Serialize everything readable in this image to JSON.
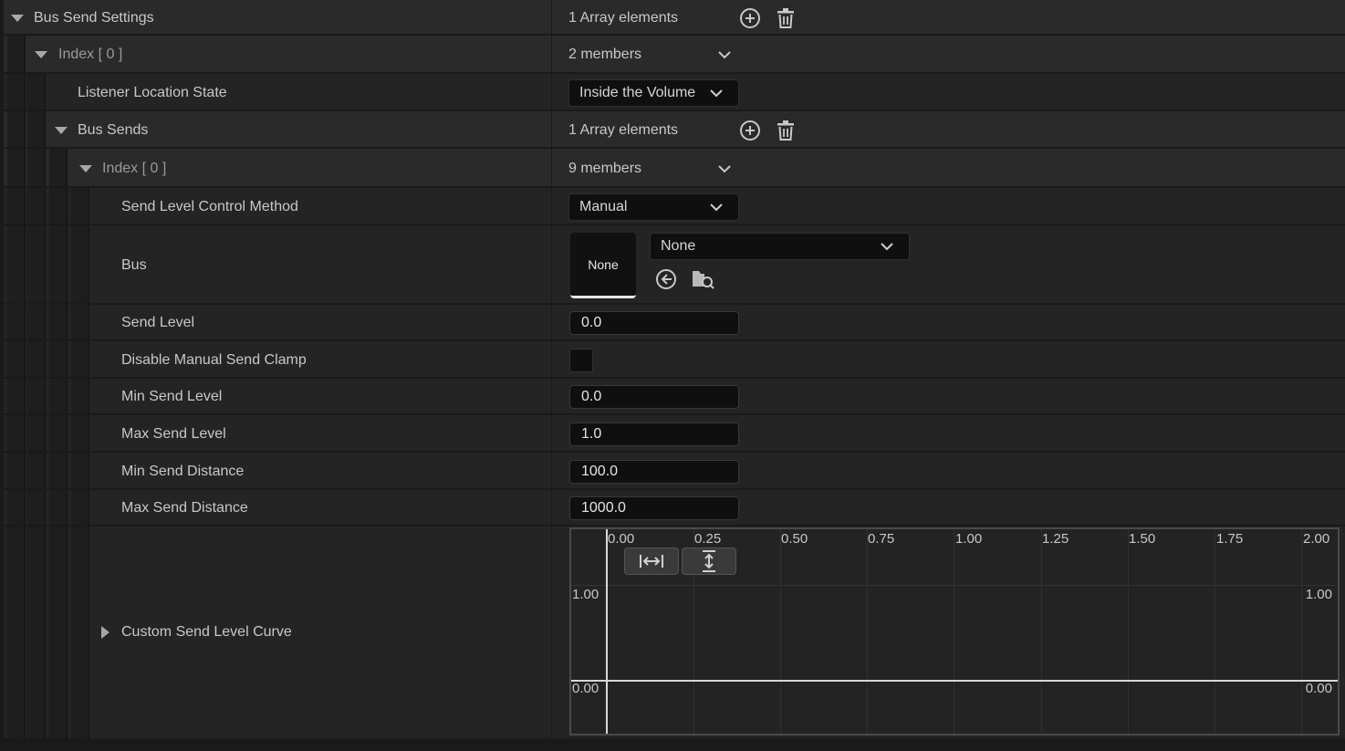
{
  "rows": {
    "bus_send_settings": {
      "label": "Bus Send Settings",
      "value": "1 Array elements"
    },
    "index0": {
      "label": "Index",
      "bracket": "[ 0 ]",
      "value": "2 members"
    },
    "listener_location_state": {
      "label": "Listener Location State",
      "value": "Inside the Volume"
    },
    "bus_sends": {
      "label": "Bus Sends",
      "value": "1 Array elements"
    },
    "bus_sends_index0": {
      "label": "Index",
      "bracket": "[ 0 ]",
      "value": "9 members"
    },
    "send_level_control_method": {
      "label": "Send Level Control Method",
      "value": "Manual"
    },
    "bus": {
      "label": "Bus",
      "thumbnail": "None",
      "value": "None"
    },
    "send_level": {
      "label": "Send Level",
      "value": "0.0"
    },
    "disable_manual_send_clamp": {
      "label": "Disable Manual Send Clamp",
      "checked": false
    },
    "min_send_level": {
      "label": "Min Send Level",
      "value": "0.0"
    },
    "max_send_level": {
      "label": "Max Send Level",
      "value": "1.0"
    },
    "min_send_distance": {
      "label": "Min Send Distance",
      "value": "100.0"
    },
    "max_send_distance": {
      "label": "Max Send Distance",
      "value": "1000.0"
    },
    "custom_send_level_curve": {
      "label": "Custom Send Level Curve"
    }
  },
  "curve": {
    "x_ticks": [
      "0.00",
      "0.25",
      "0.50",
      "0.75",
      "1.00",
      "1.25",
      "1.50",
      "1.75",
      "2.00"
    ],
    "y_left": [
      "1.00",
      "0.00"
    ],
    "y_right": [
      "1.00",
      "0.00"
    ]
  },
  "icons": {
    "add": "plus-circle-icon",
    "delete": "trash-icon",
    "chevron": "chevron-down-icon",
    "use_selected": "arrow-left-circle-icon",
    "browse": "folder-search-icon",
    "fit_horizontal": "fit-horizontal-icon",
    "fit_vertical": "fit-vertical-icon"
  },
  "colors": {
    "background": "#1a1a1a",
    "row": "#242424",
    "field": "#0f0f0f",
    "text": "#c8c8c8"
  }
}
